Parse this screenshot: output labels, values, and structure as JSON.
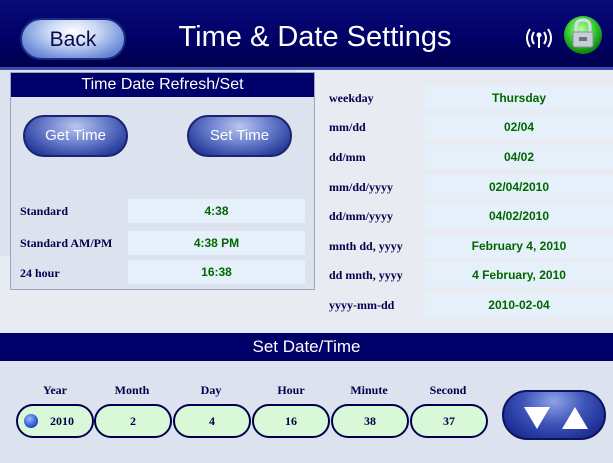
{
  "header": {
    "back_label": "Back",
    "title": "Time & Date Settings",
    "wifi_icon": "wifi-icon",
    "lock_icon": "lock-icon",
    "lock_color": "#33cc33"
  },
  "time_panel": {
    "title": "Time Date Refresh/Set",
    "get_time_label": "Get Time",
    "set_time_label": "Set Time",
    "rows": [
      {
        "label": "Standard",
        "value": "4:38"
      },
      {
        "label": "Standard AM/PM",
        "value": "4:38 PM"
      },
      {
        "label": "24 hour",
        "value": "16:38"
      }
    ]
  },
  "date_panel": {
    "rows": [
      {
        "label": "weekday",
        "value": "Thursday"
      },
      {
        "label": "mm/dd",
        "value": "02/04"
      },
      {
        "label": "dd/mm",
        "value": "04/02"
      },
      {
        "label": "mm/dd/yyyy",
        "value": "02/04/2010"
      },
      {
        "label": "dd/mm/yyyy",
        "value": "04/02/2010"
      },
      {
        "label": "mnth dd, yyyy",
        "value": "February 4, 2010"
      },
      {
        "label": "dd mnth, yyyy",
        "value": "4 February, 2010"
      },
      {
        "label": "yyyy-mm-dd",
        "value": "2010-02-04"
      }
    ]
  },
  "set_date": {
    "title": "Set Date/Time",
    "fields": [
      {
        "label": "Year",
        "value": "2010"
      },
      {
        "label": "Month",
        "value": "2"
      },
      {
        "label": "Day",
        "value": "4"
      },
      {
        "label": "Hour",
        "value": "16"
      },
      {
        "label": "Minute",
        "value": "38"
      },
      {
        "label": "Second",
        "value": "37"
      }
    ],
    "selected_field": "Year",
    "arrow_icons": [
      "down-arrow-icon",
      "up-arrow-icon"
    ]
  }
}
